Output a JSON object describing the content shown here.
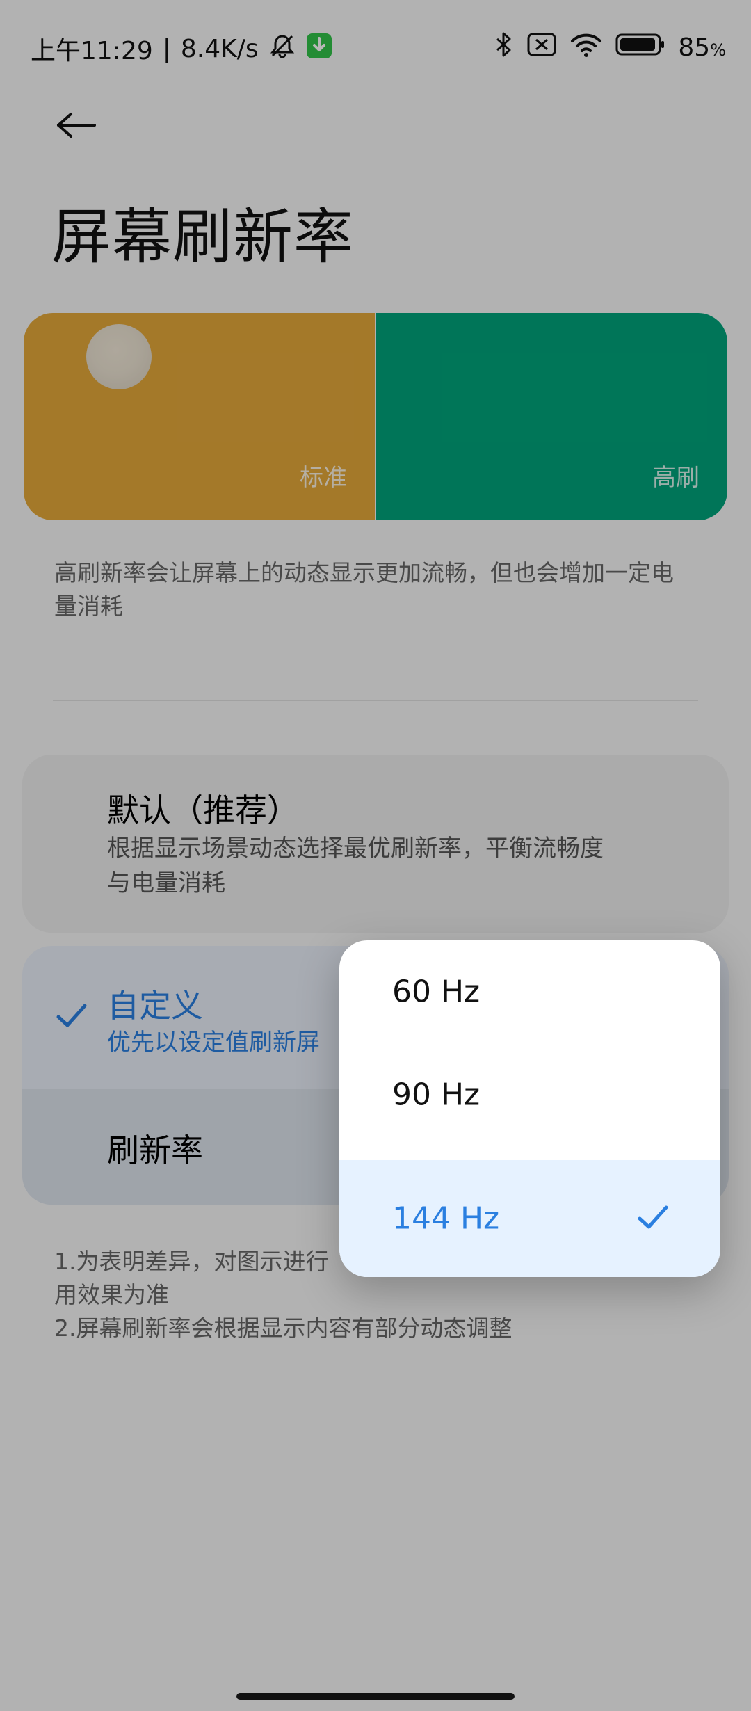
{
  "status_bar": {
    "time": "上午11:29",
    "separator": "|",
    "net_speed": "8.4K/s",
    "battery": "85",
    "battery_unit": "%"
  },
  "header": {
    "title": "屏幕刷新率"
  },
  "preview": {
    "left_label": "标准",
    "right_label": "高刷",
    "left_color": "#e3a83a",
    "right_color": "#00a37a"
  },
  "description": "高刷新率会让屏幕上的动态显示更加流畅，但也会增加一定电量消耗",
  "options": {
    "default": {
      "title": "默认（推荐）",
      "subtitle_line1": "根据显示场景动态选择最优刷新率，平衡流畅度",
      "subtitle_line2": "与电量消耗"
    },
    "custom": {
      "title": "自定义",
      "subtitle": "优先以设定值刷新屏",
      "rate_label": "刷新率"
    }
  },
  "notes": {
    "line1": "1.为表明差异，对图示进行",
    "line2": "用效果为准",
    "line3": "2.屏幕刷新率会根据显示内容有部分动态调整"
  },
  "popup": {
    "items": [
      "60 Hz",
      "90 Hz",
      "144 Hz"
    ],
    "selected": "144 Hz",
    "accent_color": "#2a7fe0"
  }
}
